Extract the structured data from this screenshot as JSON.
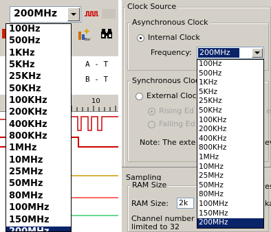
{
  "left": {
    "combo_value": "200MHz",
    "label_a": "A - T",
    "label_b": "B - T",
    "ruler_tick": "10",
    "dropdown_items": [
      "100Hz",
      "500Hz",
      "1KHz",
      "5KHz",
      "25KHz",
      "50KHz",
      "100KHz",
      "200KHz",
      "400KHz",
      "800KHz",
      "1MHz",
      "10MHz",
      "25MHz",
      "50MHz",
      "80MHz",
      "100MHz",
      "150MHz",
      "200MHz"
    ],
    "selected": "200MHz"
  },
  "right": {
    "clock_source_title": "Clock Source",
    "async_title": "Asynchronous Clock",
    "internal_clock_label": "Internal Clock",
    "frequency_label": "Frequency:",
    "frequency_value": "200MHz",
    "sync_title": "Synchronous Clock",
    "external_clock_label": "External Clock",
    "rising_edge_label": "Rising Ed",
    "falling_edge_label": "Falling Ed",
    "note_label": "Note: The exte",
    "note_tail": "ev",
    "sampling_title": "Sampling",
    "ram_size_title": "RAM Size",
    "ram_size_label": "RAM Size:",
    "ram_size_value": "2k",
    "channel_note_1": "Channel number w",
    "channel_note_2": "limited to 32",
    "cut_text_1": "es",
    "cut_text_2": "ka",
    "cut_text_3": "er",
    "dropdown_items": [
      "100Hz",
      "500Hz",
      "1KHz",
      "5KHz",
      "25KHz",
      "50KHz",
      "100KHz",
      "200KHz",
      "400KHz",
      "800KHz",
      "1MHz",
      "10MHz",
      "25MHz",
      "50MHz",
      "80MHz",
      "100MHz",
      "150MHz",
      "200MHz"
    ],
    "selected": "200MHz"
  }
}
